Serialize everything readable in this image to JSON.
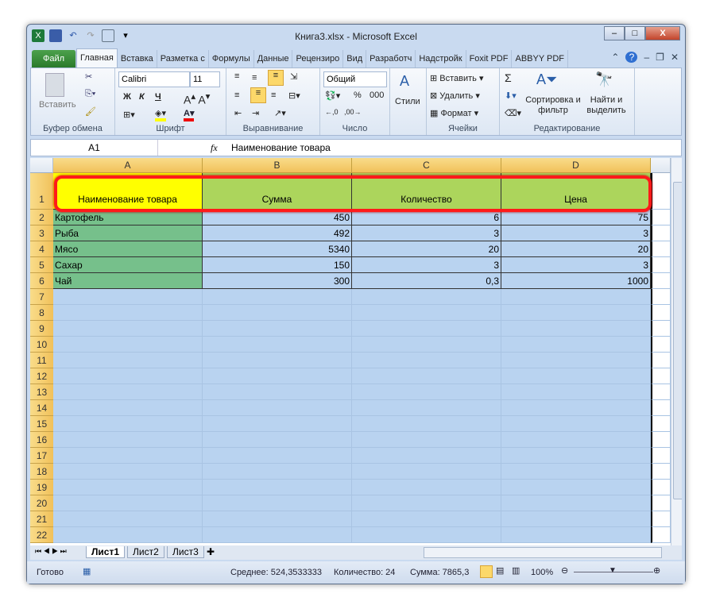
{
  "window": {
    "title": "Книга3.xlsx - Microsoft Excel"
  },
  "tabs": [
    "Файл",
    "Главная",
    "Вставка",
    "Разметка с",
    "Формулы",
    "Данные",
    "Рецензиро",
    "Вид",
    "Разработч",
    "Надстройк",
    "Foxit PDF",
    "ABBYY PDF"
  ],
  "ribbon": {
    "clipboard": {
      "paste": "Вставить",
      "label": "Буфер обмена"
    },
    "font": {
      "name": "Calibri",
      "size": "11",
      "bold": "Ж",
      "italic": "К",
      "underline": "Ч",
      "label": "Шрифт"
    },
    "alignment": {
      "label": "Выравнивание"
    },
    "number": {
      "format": "Общий",
      "percent": "%",
      "thousands": "000",
      "label": "Число"
    },
    "styles": {
      "label": "Стили"
    },
    "cells": {
      "insert": "Вставить",
      "delete": "Удалить",
      "format": "Формат",
      "label": "Ячейки"
    },
    "editing": {
      "sort": "Сортировка и фильтр",
      "find": "Найти и выделить",
      "label": "Редактирование",
      "sigma": "Σ"
    }
  },
  "formula_bar": {
    "name_box": "A1",
    "fx": "fx",
    "value": "Наименование товара"
  },
  "columns": [
    "A",
    "B",
    "C",
    "D"
  ],
  "header_row": [
    "Наименование товара",
    "Сумма",
    "Количество",
    "Цена"
  ],
  "rows": [
    [
      "Картофель",
      "450",
      "6",
      "75"
    ],
    [
      "Рыба",
      "492",
      "3",
      "3"
    ],
    [
      "Мясо",
      "5340",
      "20",
      "20"
    ],
    [
      "Сахар",
      "150",
      "3",
      "3"
    ],
    [
      "Чай",
      "300",
      "0,3",
      "1000"
    ]
  ],
  "row_numbers": [
    "1",
    "2",
    "3",
    "4",
    "5",
    "6",
    "7",
    "8",
    "9",
    "10",
    "11",
    "12",
    "13",
    "14",
    "15",
    "16",
    "17",
    "18",
    "19",
    "20",
    "21",
    "22"
  ],
  "sheets": [
    "Лист1",
    "Лист2",
    "Лист3"
  ],
  "status": {
    "ready": "Готово",
    "average": "Среднее: 524,3533333",
    "count": "Количество: 24",
    "sum": "Сумма: 7865,3",
    "zoom": "100%"
  }
}
